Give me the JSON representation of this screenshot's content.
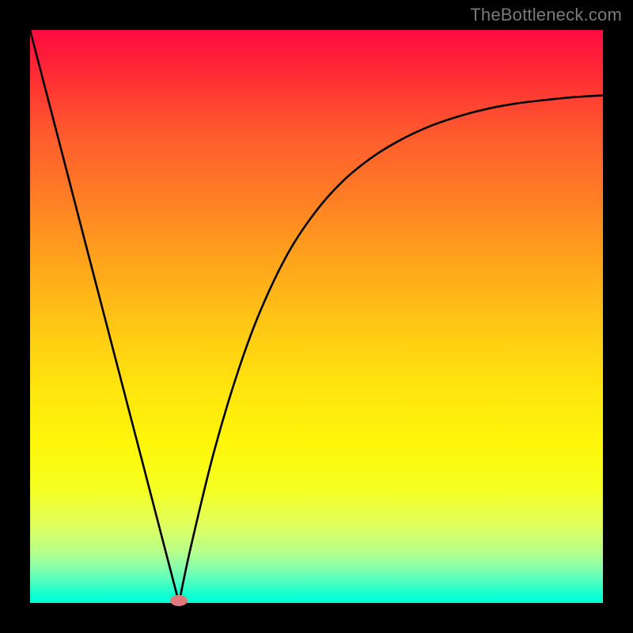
{
  "watermark": "TheBottleneck.com",
  "colors": {
    "frame": "#000000",
    "curve": "#000000",
    "marker": "#e07a7a"
  },
  "chart_data": {
    "type": "line",
    "title": "",
    "xlabel": "",
    "ylabel": "",
    "xlim": [
      0,
      100
    ],
    "ylim": [
      0,
      100
    ],
    "grid": false,
    "legend": false,
    "annotations": [],
    "min_point": {
      "x": 26,
      "y": 0
    },
    "series": [
      {
        "name": "curve",
        "x": [
          0,
          5,
          10,
          15,
          20,
          24,
          26,
          28,
          32,
          36,
          40,
          45,
          50,
          55,
          60,
          65,
          70,
          75,
          80,
          85,
          90,
          95,
          100
        ],
        "y": [
          100,
          80.8,
          61.5,
          42.3,
          23.1,
          7.7,
          0,
          9.5,
          26.0,
          39.5,
          50.5,
          61.0,
          68.5,
          74.0,
          78.0,
          81.0,
          83.3,
          85.0,
          86.3,
          87.2,
          87.8,
          88.3,
          88.6
        ]
      }
    ]
  }
}
